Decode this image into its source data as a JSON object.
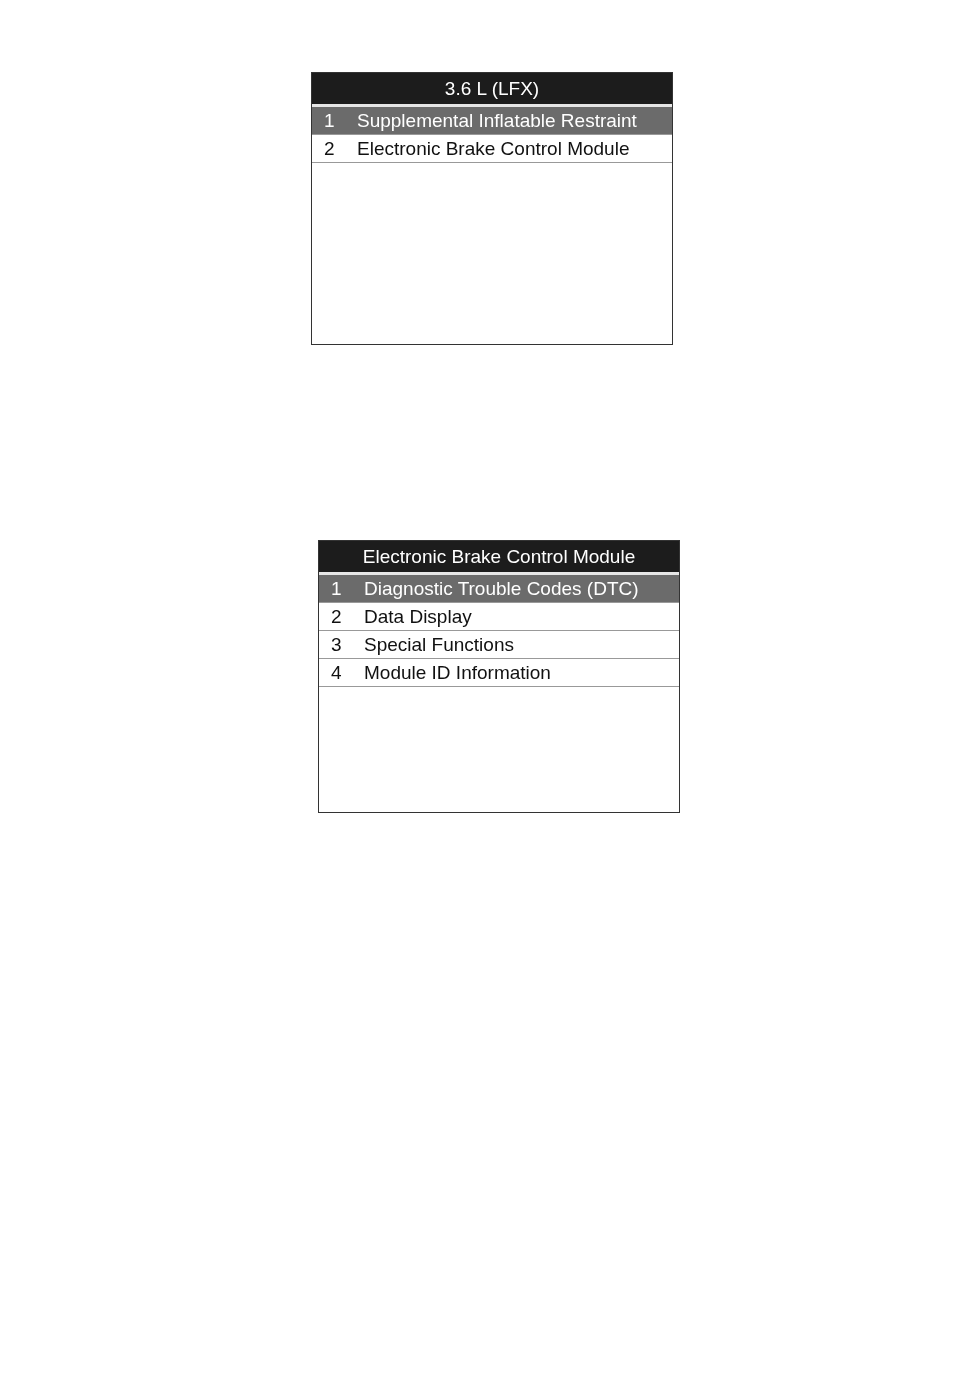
{
  "screens": [
    {
      "title": "3.6 L (LFX)",
      "items": [
        {
          "number": "1",
          "label": "Supplemental Inflatable Restraint",
          "selected": true
        },
        {
          "number": "2",
          "label": "Electronic Brake Control Module",
          "selected": false
        }
      ]
    },
    {
      "title": "Electronic Brake Control Module",
      "items": [
        {
          "number": "1",
          "label": "Diagnostic Trouble Codes (DTC)",
          "selected": true
        },
        {
          "number": "2",
          "label": "Data Display",
          "selected": false
        },
        {
          "number": "3",
          "label": "Special Functions",
          "selected": false
        },
        {
          "number": "4",
          "label": "Module ID Information",
          "selected": false
        }
      ]
    }
  ]
}
